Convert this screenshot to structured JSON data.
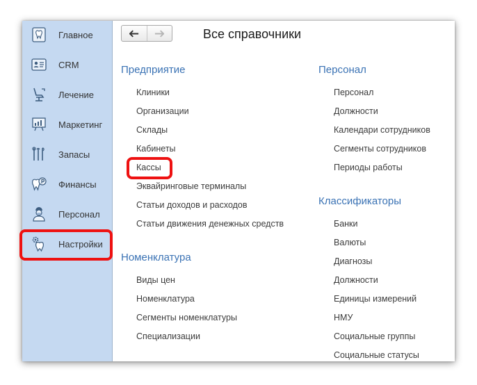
{
  "sidebar": {
    "items": [
      {
        "label": "Главное",
        "icon": "home-tooth-icon"
      },
      {
        "label": "CRM",
        "icon": "crm-card-icon"
      },
      {
        "label": "Лечение",
        "icon": "dental-chair-icon"
      },
      {
        "label": "Маркетинг",
        "icon": "presentation-board-icon"
      },
      {
        "label": "Запасы",
        "icon": "dental-tools-icon"
      },
      {
        "label": "Финансы",
        "icon": "tooth-coin-icon"
      },
      {
        "label": "Персонал",
        "icon": "doctor-icon"
      },
      {
        "label": "Настройки",
        "icon": "tooth-gear-icon"
      }
    ]
  },
  "toolbar": {
    "back_glyph": "🡐",
    "forward_glyph": "🡒"
  },
  "page": {
    "title": "Все справочники"
  },
  "sections": {
    "enterprise": {
      "title": "Предприятие",
      "items": [
        "Клиники",
        "Организации",
        "Склады",
        "Кабинеты",
        "Кассы",
        "Эквайринговые терминалы",
        "Статьи доходов и расходов",
        "Статьи движения денежных средств"
      ]
    },
    "nomenclature": {
      "title": "Номенклатура",
      "items": [
        "Виды цен",
        "Номенклатура",
        "Сегменты номенклатуры",
        "Специализации"
      ]
    },
    "personnel": {
      "title": "Персонал",
      "items": [
        "Персонал",
        "Должности",
        "Календари сотрудников",
        "Сегменты сотрудников",
        "Периоды работы"
      ]
    },
    "classifiers": {
      "title": "Классификаторы",
      "items": [
        "Банки",
        "Валюты",
        "Диагнозы",
        "Должности",
        "Единицы измерений",
        "НМУ",
        "Социальные группы",
        "Социальные статусы"
      ]
    }
  },
  "colors": {
    "sidebar_bg": "#c5d9f1",
    "section_title": "#3a72b4",
    "highlight": "#ee1111"
  }
}
